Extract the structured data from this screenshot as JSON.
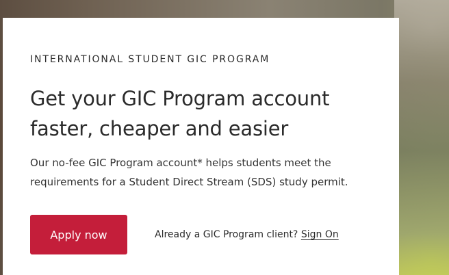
{
  "card": {
    "eyebrow": "INTERNATIONAL STUDENT GIC PROGRAM",
    "headline_line1": "Get your GIC Program account",
    "headline_line2": "faster, cheaper and easier",
    "body_line1": "Our no-fee GIC Program account* helps students meet the",
    "body_line2": "requirements for a Student Direct Stream (SDS) study permit.",
    "apply_label": "Apply now",
    "client_prompt": "Already a GIC Program client?",
    "signon_label": "Sign On"
  },
  "colors": {
    "accent": "#c41e3a",
    "text": "#2b2b2b",
    "card_bg": "#ffffff"
  }
}
